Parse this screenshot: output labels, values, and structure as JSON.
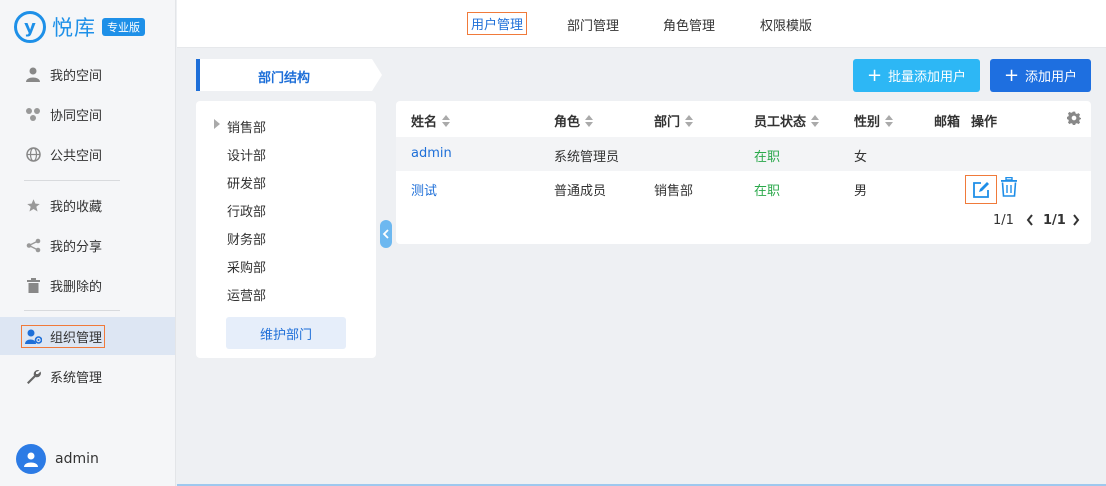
{
  "brand": {
    "logo_glyph": "y",
    "name": "悦库",
    "edition": "专业版",
    "color": "#1e90e8"
  },
  "sidebar": {
    "items": [
      {
        "label": "我的空间",
        "icon": "person-icon"
      },
      {
        "label": "协同空间",
        "icon": "collab-icon"
      },
      {
        "label": "公共空间",
        "icon": "globe-icon"
      },
      {
        "label": "我的收藏",
        "icon": "star-icon"
      },
      {
        "label": "我的分享",
        "icon": "share-icon"
      },
      {
        "label": "我删除的",
        "icon": "trash-icon"
      },
      {
        "label": "组织管理",
        "icon": "org-icon",
        "active": true
      },
      {
        "label": "系统管理",
        "icon": "wrench-icon"
      }
    ],
    "user": "admin"
  },
  "topnav": {
    "tabs": [
      {
        "label": "用户管理",
        "active": true
      },
      {
        "label": "部门管理"
      },
      {
        "label": "角色管理"
      },
      {
        "label": "权限模版"
      }
    ]
  },
  "dept": {
    "title": "部门结构",
    "items": [
      "销售部",
      "设计部",
      "研发部",
      "行政部",
      "财务部",
      "采购部",
      "运营部"
    ],
    "maintain_label": "维护部门"
  },
  "actions": {
    "batch_add": "批量添加用户",
    "add": "添加用户",
    "batch_color": "#2db7f5",
    "add_color": "#1e6fe0"
  },
  "table": {
    "headers": {
      "name": "姓名",
      "role": "角色",
      "dept": "部门",
      "status": "员工状态",
      "gender": "性别",
      "email": "邮箱",
      "ops": "操作"
    },
    "rows": [
      {
        "name": "admin",
        "role": "系统管理员",
        "dept": "",
        "status": "在职",
        "gender": "女"
      },
      {
        "name": "测试",
        "role": "普通成员",
        "dept": "销售部",
        "status": "在职",
        "gender": "男"
      }
    ],
    "pager": {
      "total": "1/1",
      "current": "1/1"
    }
  }
}
